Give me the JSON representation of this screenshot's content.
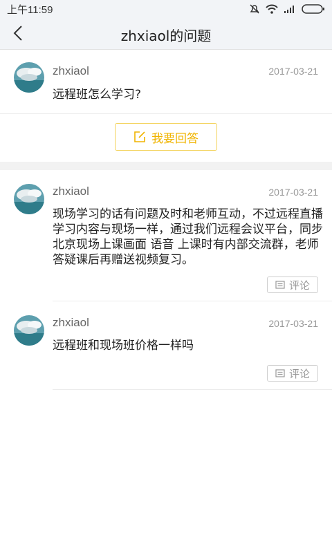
{
  "status_bar": {
    "time": "上午11:59"
  },
  "nav": {
    "title": "zhxiaol的问题"
  },
  "question": {
    "user": "zhxiaol",
    "date": "2017-03-21",
    "text": "远程班怎么学习?",
    "answer_button": "我要回答"
  },
  "answers": [
    {
      "user": "zhxiaol",
      "date": "2017-03-21",
      "text": "现场学习的话有问题及时和老师互动，不过远程直播学习内容与现场一样，通过我们远程会议平台，同步北京现场上课画面 语音 上课时有内部交流群，老师答疑课后再赠送视频复习。",
      "comment_label": "评论"
    },
    {
      "user": "zhxiaol",
      "date": "2017-03-21",
      "text": "远程班和现场班价格一样吗",
      "comment_label": "评论"
    }
  ],
  "colors": {
    "accent": "#f0b400",
    "nav_bg": "#f2f4f7"
  },
  "icons": [
    "back-arrow-icon",
    "edit-icon",
    "comment-icon",
    "avatar-cloud-icon"
  ]
}
